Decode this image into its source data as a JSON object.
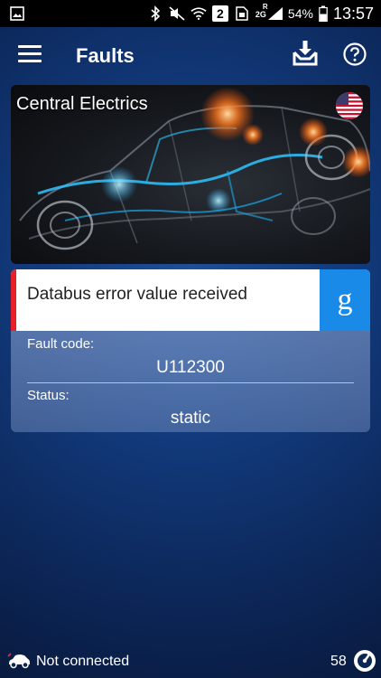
{
  "status_bar": {
    "left_icons": [
      "gallery-icon"
    ],
    "right_icons": [
      "bluetooth-icon",
      "mute-icon",
      "wifi-icon",
      "sim-icon",
      "signal-icon"
    ],
    "sim_number": "2",
    "network_type": "2G",
    "roaming_mark": "R",
    "battery": "54%",
    "time": "13:57"
  },
  "app_bar": {
    "title": "Faults",
    "icons": [
      "menu-icon",
      "save-inbox-icon",
      "help-icon"
    ]
  },
  "hero": {
    "title": "Central Electrics",
    "flag_icon": "us-flag-icon"
  },
  "fault": {
    "description": "Databus error value received",
    "search_label": "g",
    "code_label": "Fault code:",
    "code_value": "U112300",
    "status_label": "Status:",
    "status_value": "static",
    "accent_color": "#e8202a",
    "search_color": "#1a8ae8"
  },
  "bottom_bar": {
    "connection_text": "Not connected",
    "count": "58",
    "icons": [
      "car-connection-icon",
      "gauge-icon"
    ]
  }
}
